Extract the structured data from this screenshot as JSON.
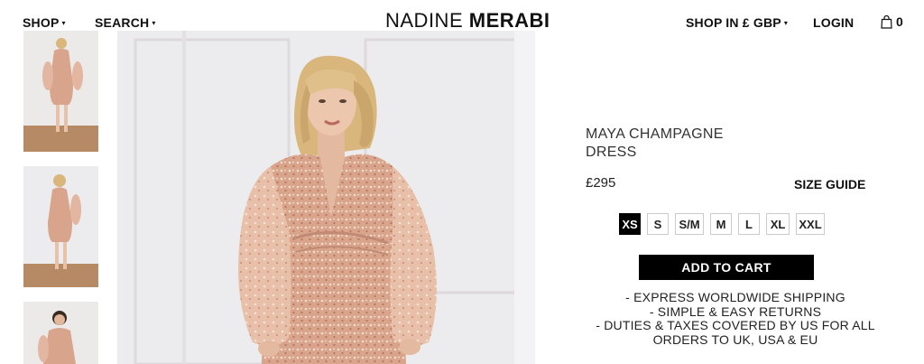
{
  "header": {
    "shop_label": "SHOP",
    "search_label": "SEARCH",
    "logo_light": "NADINE ",
    "logo_bold": "MERABI",
    "currency_label": "SHOP IN £ GBP",
    "login_label": "LOGIN",
    "bag_count": "0",
    "bag_icon": "shopping-bag-icon"
  },
  "product": {
    "title_line1": "MAYA CHAMPAGNE",
    "title_line2": "DRESS",
    "price": "£295",
    "size_guide_label": "SIZE GUIDE",
    "sizes": [
      "XS",
      "S",
      "S/M",
      "M",
      "L",
      "XL",
      "XXL"
    ],
    "selected_size": "XS",
    "add_to_cart_label": "ADD TO CART",
    "benefits": [
      "- EXPRESS WORLDWIDE SHIPPING",
      "- SIMPLE & EASY RETURNS",
      "- DUTIES & TAXES COVERED BY US FOR ALL",
      "ORDERS TO UK, USA & EU"
    ]
  },
  "colors": {
    "dress": "#d9a48c",
    "sequin": "#f3d2bf",
    "wall": "#ecebed",
    "floor": "#b58a64",
    "hair": "#d8b67c",
    "skin": "#e8c2a8",
    "accent": "#000000"
  }
}
